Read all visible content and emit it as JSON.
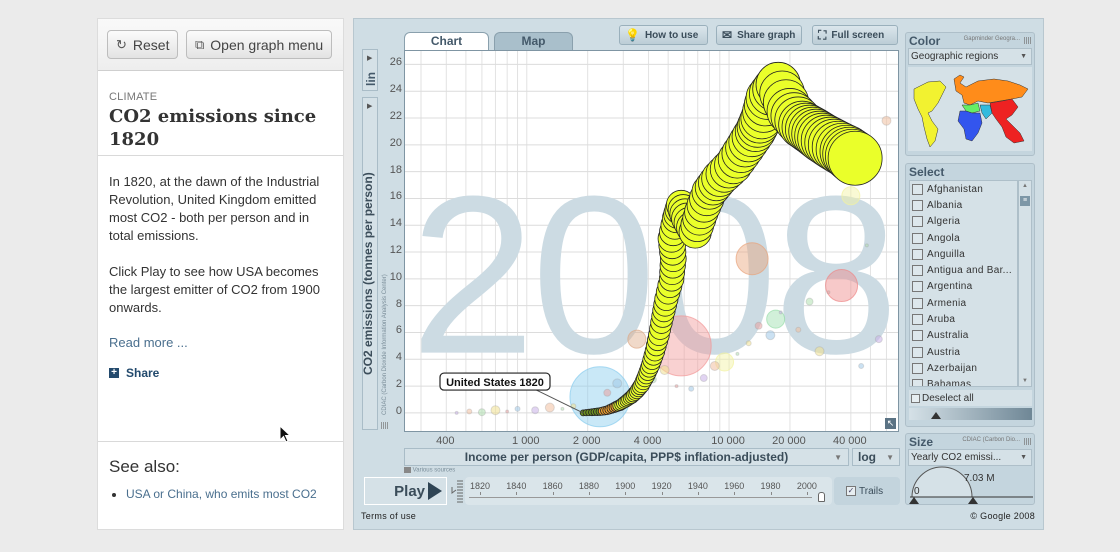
{
  "left_panel": {
    "reset_label": "Reset",
    "open_menu_label": "Open graph menu",
    "category": "CLIMATE",
    "title": "CO2 emissions since 1820",
    "paragraphs": [
      "In 1820, at the dawn of the Industrial Revolution, United Kingdom emitted most CO2 - both per person and in total emissions.",
      "Click Play to see how USA becomes the largest emitter of CO2 from 1900 onwards."
    ],
    "read_more": "Read more ...",
    "share": "Share",
    "see_also_title": "See also:",
    "see_also_links": [
      "USA or China, who emits most CO2"
    ]
  },
  "graph": {
    "tabs": [
      {
        "label": "Chart",
        "active": true
      },
      {
        "label": "Map",
        "active": false
      }
    ],
    "toolbar": {
      "how_to_use": "How to use",
      "share_graph": "Share graph",
      "full_screen": "Full screen"
    },
    "y_scale": "lin",
    "year_watermark": "2008",
    "tooltip_label": "United States 1820",
    "x_scale": "log",
    "x_source": "Various sources",
    "y_source": "CDIAC (Carbon Dioxide Information Analysis Center)",
    "play_label": "Play",
    "trails_label": "Trails",
    "trails_checked": true,
    "timeline_years": [
      "1820",
      "1840",
      "1860",
      "1880",
      "1900",
      "1920",
      "1940",
      "1960",
      "1980",
      "2000"
    ],
    "timeline_position_year": 2008,
    "terms": "Terms of use",
    "copyright": "© Google 2008"
  },
  "color_panel": {
    "title": "Color",
    "source": "Gapminder Geogra...",
    "selected": "Geographic regions",
    "region_colors": {
      "americas": "#f2f230",
      "europe_central_asia": "#ff8c1a",
      "africa": "#3355ee",
      "middle_east": "#66ee66",
      "south_asia": "#33bbdd",
      "east_asia_pacific": "#ee2222"
    }
  },
  "select_panel": {
    "title": "Select",
    "countries": [
      "Afghanistan",
      "Albania",
      "Algeria",
      "Angola",
      "Anguilla",
      "Antigua and Bar...",
      "Argentina",
      "Armenia",
      "Aruba",
      "Australia",
      "Austria",
      "Azerbaijan",
      "Bahamas"
    ],
    "deselect_all": "Deselect all"
  },
  "size_panel": {
    "title": "Size",
    "source": "CDIAC (Carbon Dio...",
    "selected": "Yearly CO2 emissi...",
    "min_label": "0",
    "max_label": "7.03 M"
  },
  "chart_data": {
    "type": "scatter",
    "title": "",
    "xlabel": "Income per person (GDP/capita, PPP$ inflation-adjusted)",
    "ylabel": "CO2 emissions (tonnes per person)",
    "x_scale": "log",
    "xlim": [
      250,
      70000
    ],
    "ylim": [
      -1.5,
      27
    ],
    "x_ticks": [
      400,
      1000,
      2000,
      4000,
      10000,
      20000,
      40000
    ],
    "x_tick_labels": [
      "400",
      "1 000",
      "2 000",
      "4 000",
      "10 000",
      "20 000",
      "40 000"
    ],
    "y_ticks": [
      0,
      2,
      4,
      6,
      8,
      10,
      12,
      14,
      16,
      18,
      20,
      22,
      24,
      26
    ],
    "grid": true,
    "year": 2008,
    "highlight_trail": {
      "name": "United States",
      "from_year": 1820,
      "to_year": 2008,
      "points": [
        [
          1900,
          0.0
        ],
        [
          2100,
          0.05
        ],
        [
          2300,
          0.1
        ],
        [
          2500,
          0.2
        ],
        [
          2700,
          0.4
        ],
        [
          2900,
          0.6
        ],
        [
          3100,
          0.9
        ],
        [
          3300,
          1.2
        ],
        [
          3500,
          1.6
        ],
        [
          3700,
          2.1
        ],
        [
          3900,
          2.8
        ],
        [
          4100,
          3.6
        ],
        [
          4300,
          4.6
        ],
        [
          4500,
          5.8
        ],
        [
          4700,
          7.2
        ],
        [
          4900,
          8.5
        ],
        [
          5200,
          10
        ],
        [
          5300,
          11.5
        ],
        [
          5200,
          13
        ],
        [
          5500,
          14.5
        ],
        [
          5800,
          15.5
        ],
        [
          6200,
          14.5
        ],
        [
          6800,
          13.5
        ],
        [
          7300,
          15
        ],
        [
          8000,
          16.5
        ],
        [
          9000,
          17.5
        ],
        [
          10500,
          18.5
        ],
        [
          12000,
          19.8
        ],
        [
          13500,
          21
        ],
        [
          14500,
          22
        ],
        [
          15500,
          23.5
        ],
        [
          17500,
          24.5
        ],
        [
          20000,
          22.5
        ],
        [
          23000,
          21.5
        ],
        [
          26000,
          21
        ],
        [
          29000,
          20.5
        ],
        [
          33000,
          20
        ],
        [
          38000,
          19.5
        ],
        [
          42000,
          19
        ]
      ]
    },
    "background_bubbles": [
      {
        "x": 5800,
        "y": 5.0,
        "size": "large",
        "color": "#f29999"
      },
      {
        "x": 2300,
        "y": 1.2,
        "size": "large",
        "color": "#88ccee"
      },
      {
        "x": 13000,
        "y": 11.5,
        "size": "medium",
        "color": "#e8a37a"
      },
      {
        "x": 36000,
        "y": 9.5,
        "size": "medium",
        "color": "#ee8888"
      },
      {
        "x": 40000,
        "y": 16.2,
        "size": "small",
        "color": "#f2f2a0"
      },
      {
        "x": 17000,
        "y": 7.0,
        "size": "small",
        "color": "#99ddaa"
      },
      {
        "x": 9500,
        "y": 3.8,
        "size": "small",
        "color": "#f2f2a0"
      },
      {
        "x": 3500,
        "y": 5.5,
        "size": "small",
        "color": "#ddaa88"
      }
    ]
  }
}
